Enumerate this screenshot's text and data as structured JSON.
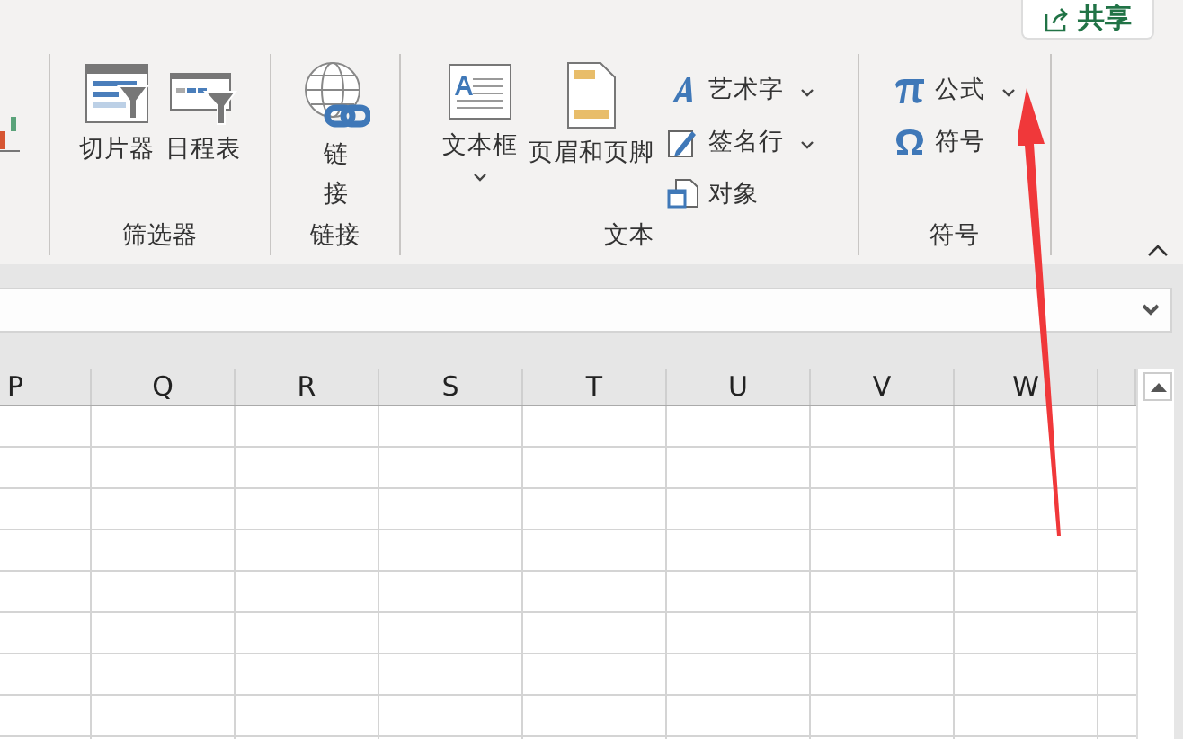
{
  "ribbon": {
    "share_button": "共享",
    "groups": [
      {
        "label": "筛选器",
        "items": [
          {
            "kind": "slicer",
            "label": "切片器",
            "dropdown": false
          },
          {
            "kind": "timeline",
            "label": "日程表",
            "dropdown": false
          }
        ]
      },
      {
        "label": "链接",
        "items": [
          {
            "kind": "link",
            "label": "链接",
            "dropdown": false
          }
        ]
      },
      {
        "label": "文本",
        "items": [
          {
            "kind": "textbox",
            "label": "文本框",
            "dropdown": true
          },
          {
            "kind": "header-footer",
            "label": "页眉和页脚",
            "dropdown": false
          },
          {
            "kind": "wordart",
            "label": "艺术字",
            "dropdown": true
          },
          {
            "kind": "signature",
            "label": "签名行",
            "dropdown": true
          },
          {
            "kind": "object",
            "label": "对象",
            "dropdown": false
          }
        ]
      },
      {
        "label": "符号",
        "items": [
          {
            "kind": "equation",
            "label": "公式",
            "dropdown": true
          },
          {
            "kind": "symbol",
            "label": "符号",
            "dropdown": false
          }
        ]
      }
    ]
  },
  "sheet": {
    "columns": [
      "P",
      "Q",
      "R",
      "S",
      "T",
      "U",
      "V",
      "W"
    ]
  }
}
